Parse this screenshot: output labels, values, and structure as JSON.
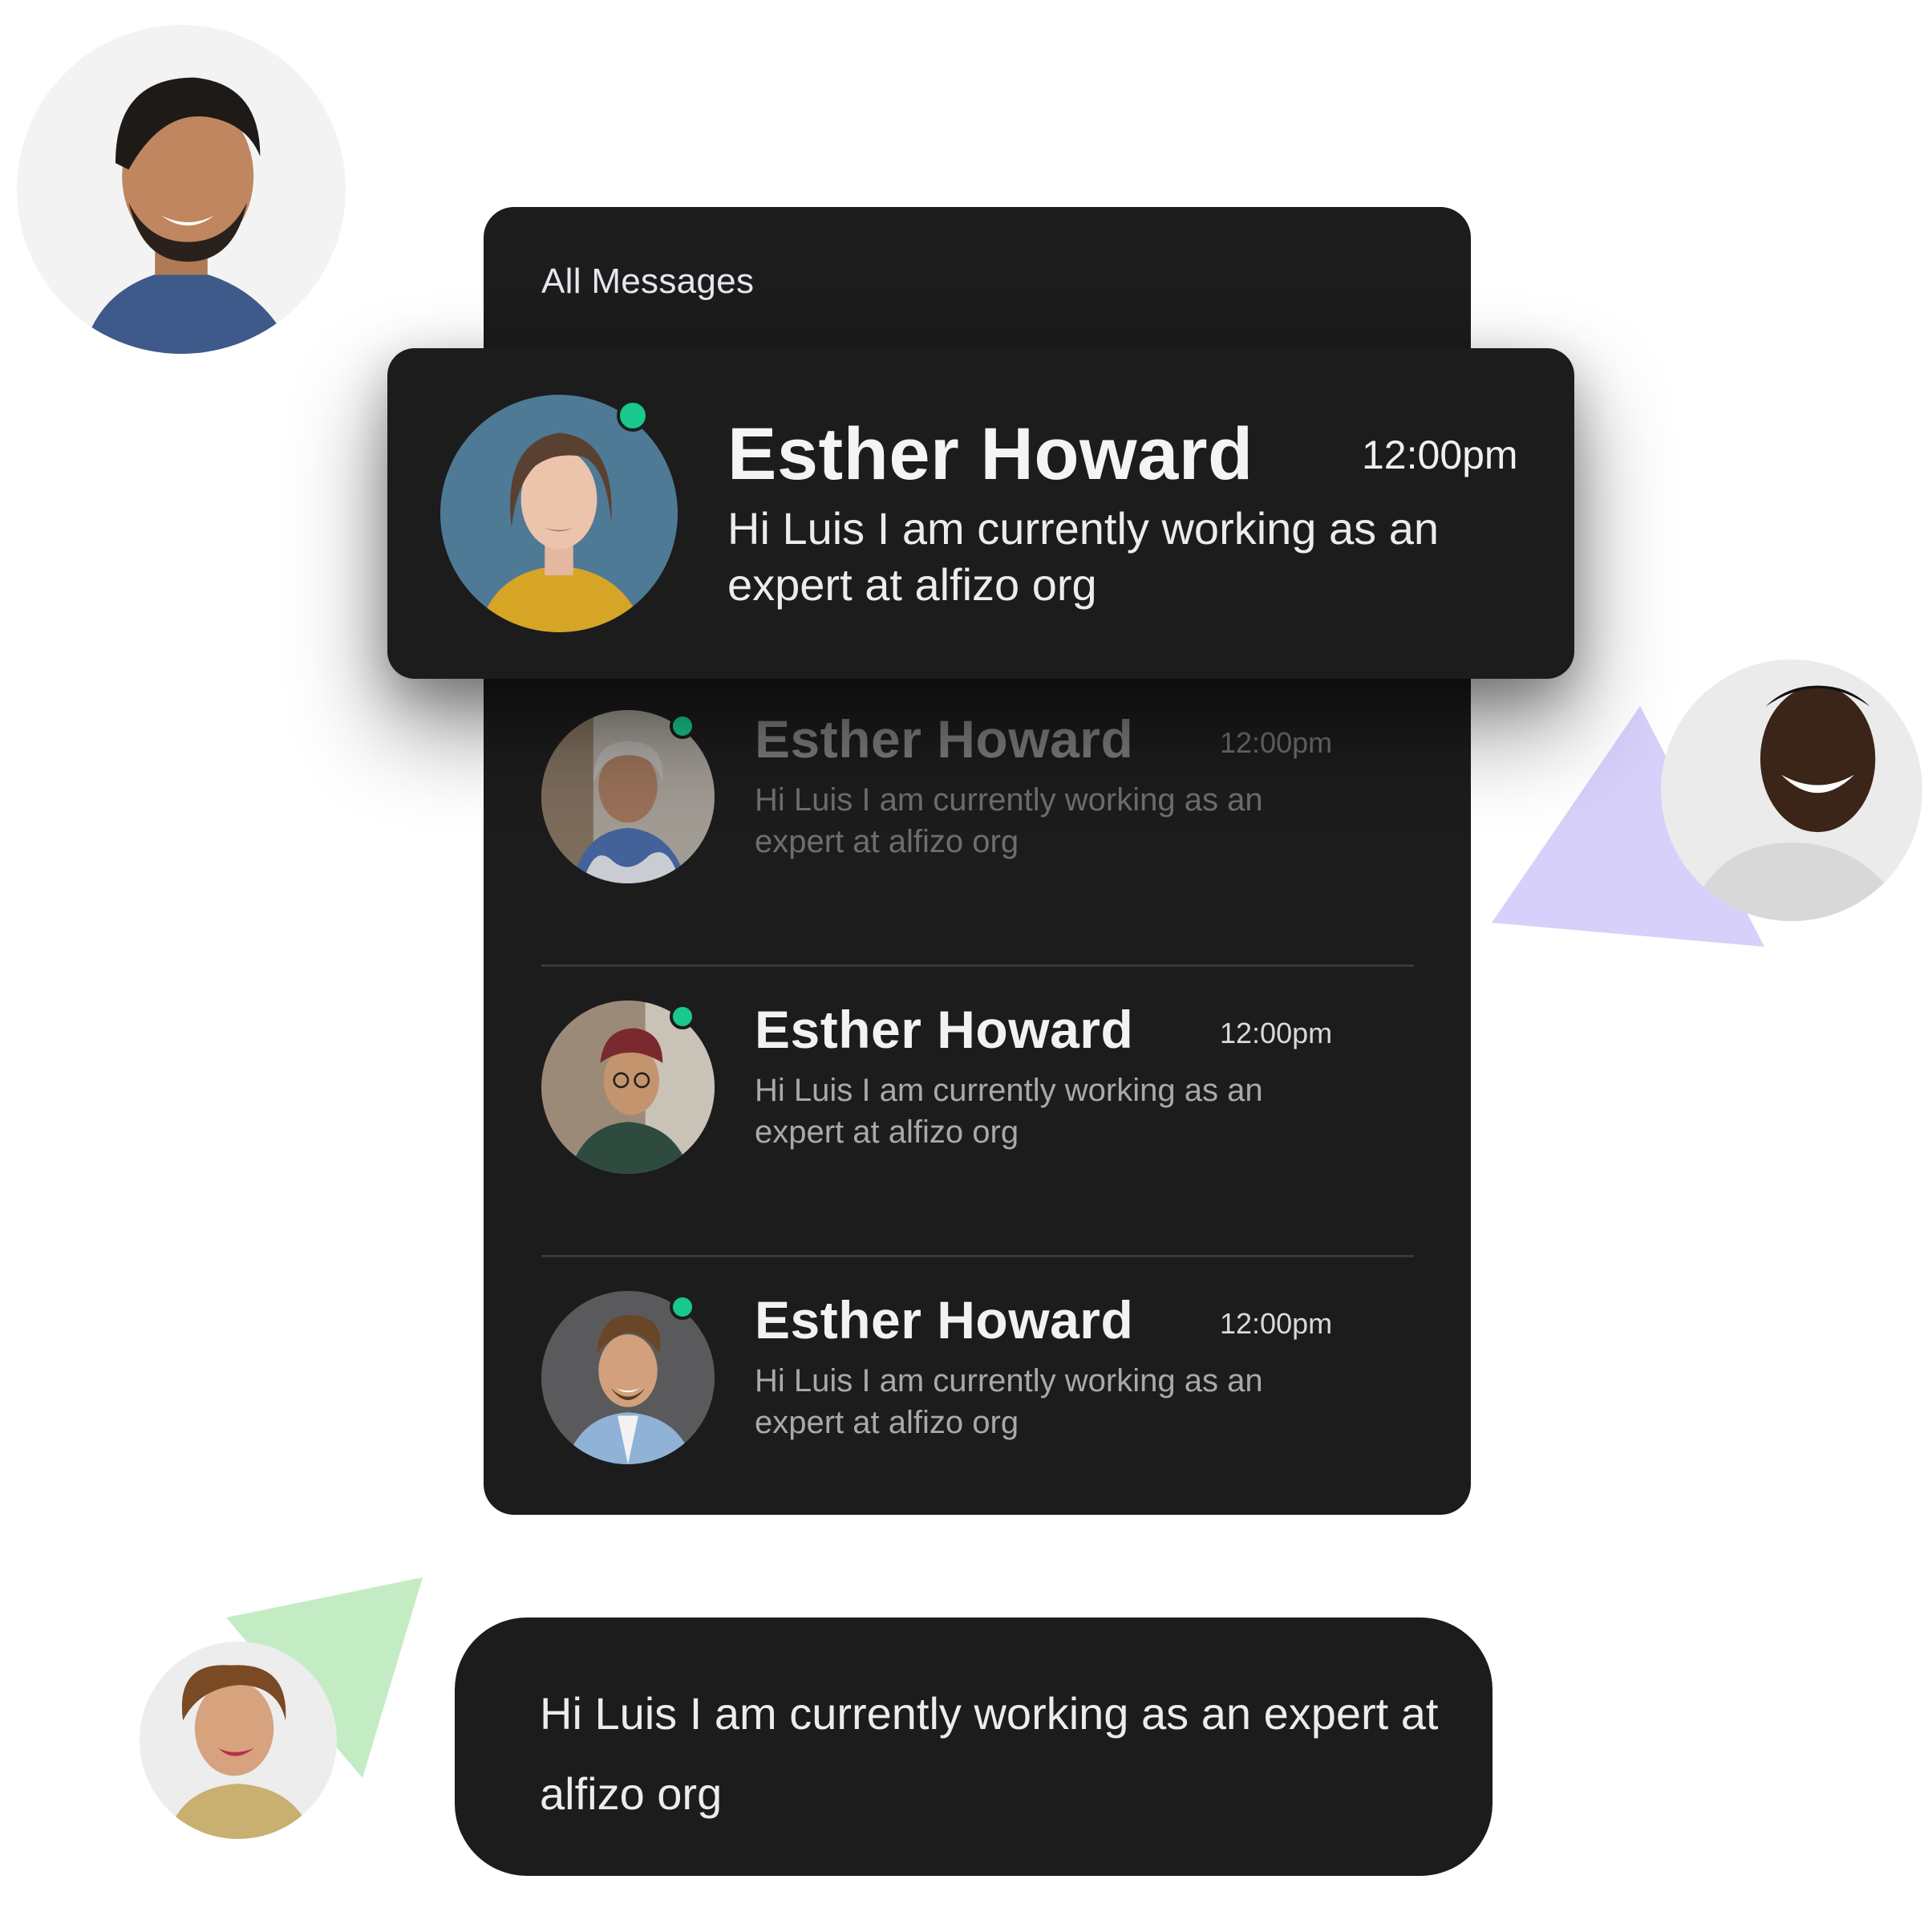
{
  "colors": {
    "panel_bg": "#1c1c1c",
    "online_dot": "#19c88c",
    "triangle_purple": "#d6d0fb",
    "triangle_green": "#c4ecc4"
  },
  "icons": {
    "online_indicator": "online-status-dot-icon"
  },
  "messages_panel": {
    "title": "All Messages",
    "highlighted": {
      "name": "Esther Howard",
      "time": "12:00pm",
      "message": "Hi Luis I am currently working as an expert at alfizo org",
      "online": true
    },
    "rows": [
      {
        "name": "Esther Howard",
        "time": "12:00pm",
        "message": "Hi Luis I am currently working as an expert at alfizo org",
        "online": true
      },
      {
        "name": "Esther Howard",
        "time": "12:00pm",
        "message": "Hi Luis I am currently working as an expert at alfizo org",
        "online": true
      },
      {
        "name": "Esther Howard",
        "time": "12:00pm",
        "message": "Hi Luis I am currently working as an expert at alfizo org",
        "online": true
      }
    ]
  },
  "bubble": {
    "message": "Hi Luis I am currently working as an expert at alfizo org"
  }
}
